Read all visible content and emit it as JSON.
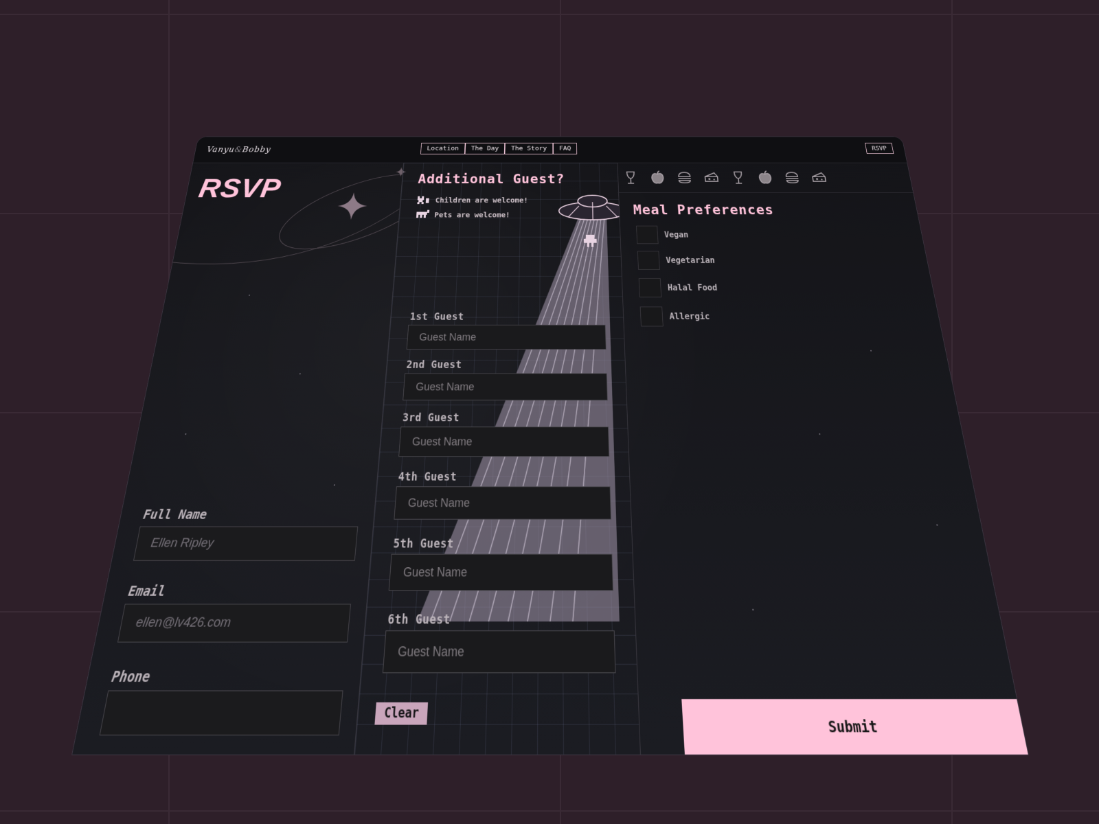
{
  "brand": {
    "name1": "Vanyu",
    "amp": "&",
    "name2": "Bobby"
  },
  "nav": {
    "items": [
      "Location",
      "The Day",
      "The Story",
      "FAQ"
    ],
    "rsvp": "RSVP"
  },
  "left": {
    "title": "RSVP",
    "fields": [
      {
        "label": "Full Name",
        "placeholder": "Ellen Ripley"
      },
      {
        "label": "Email",
        "placeholder": "ellen@lv426.com"
      },
      {
        "label": "Phone",
        "placeholder": ""
      }
    ]
  },
  "middle": {
    "title": "Additional Guest?",
    "notes": [
      "Children are welcome!",
      "Pets are welcome!"
    ],
    "guests": [
      {
        "label": "1st Guest",
        "placeholder": "Guest Name"
      },
      {
        "label": "2nd Guest",
        "placeholder": "Guest Name"
      },
      {
        "label": "3rd Guest",
        "placeholder": "Guest Name"
      },
      {
        "label": "4th Guest",
        "placeholder": "Guest Name"
      },
      {
        "label": "5th Guest",
        "placeholder": "Guest Name"
      },
      {
        "label": "6th Guest",
        "placeholder": "Guest Name"
      }
    ],
    "clear": "Clear"
  },
  "right": {
    "food_icons": [
      "wine-glass-icon",
      "apple-icon",
      "burger-icon",
      "cheese-icon",
      "wine-glass-icon",
      "apple-icon",
      "burger-icon",
      "cheese-icon"
    ],
    "title": "Meal Preferences",
    "options": [
      "Vegan",
      "Vegetarian",
      "Halal Food",
      "Allergic"
    ],
    "submit": "Submit"
  },
  "colors": {
    "accent": "#ffc3da",
    "panel": "#141418",
    "background": "#2e1f29",
    "clear_button": "#c9a5bb"
  }
}
